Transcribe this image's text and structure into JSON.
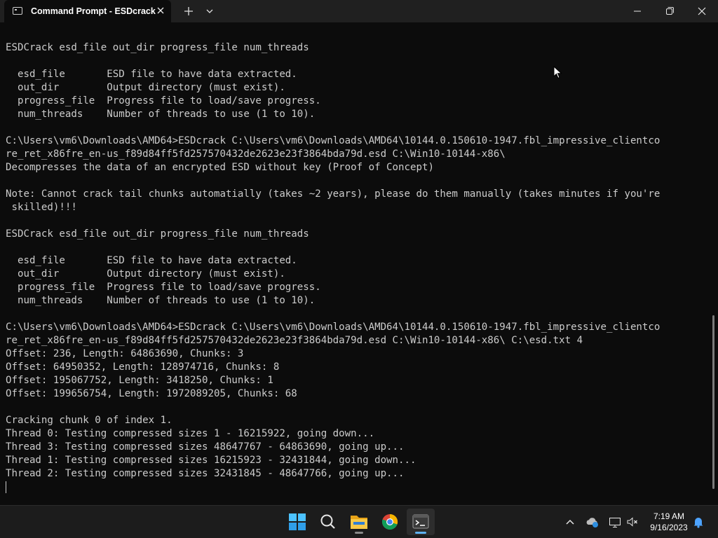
{
  "window": {
    "tab_title": "Command Prompt - ESDcrack",
    "tab_icon": "cmd-icon",
    "new_tab_icon": "plus-icon",
    "dropdown_icon": "chevron-down-icon",
    "minimize_icon": "minimize-icon",
    "restore_icon": "restore-icon",
    "close_icon": "close-icon"
  },
  "terminal": {
    "lines": [
      "ESDCrack esd_file out_dir progress_file num_threads",
      "",
      "  esd_file       ESD file to have data extracted.",
      "  out_dir        Output directory (must exist).",
      "  progress_file  Progress file to load/save progress.",
      "  num_threads    Number of threads to use (1 to 10).",
      "",
      "C:\\Users\\vm6\\Downloads\\AMD64>ESDcrack C:\\Users\\vm6\\Downloads\\AMD64\\10144.0.150610-1947.fbl_impressive_clientco",
      "re_ret_x86fre_en-us_f89d84ff5fd257570432de2623e23f3864bda79d.esd C:\\Win10-10144-x86\\",
      "Decompresses the data of an encrypted ESD without key (Proof of Concept)",
      "",
      "Note: Cannot crack tail chunks automatially (takes ~2 years), please do them manually (takes minutes if you're",
      " skilled)!!!",
      "",
      "ESDCrack esd_file out_dir progress_file num_threads",
      "",
      "  esd_file       ESD file to have data extracted.",
      "  out_dir        Output directory (must exist).",
      "  progress_file  Progress file to load/save progress.",
      "  num_threads    Number of threads to use (1 to 10).",
      "",
      "C:\\Users\\vm6\\Downloads\\AMD64>ESDcrack C:\\Users\\vm6\\Downloads\\AMD64\\10144.0.150610-1947.fbl_impressive_clientco",
      "re_ret_x86fre_en-us_f89d84ff5fd257570432de2623e23f3864bda79d.esd C:\\Win10-10144-x86\\ C:\\esd.txt 4",
      "Offset: 236, Length: 64863690, Chunks: 3",
      "Offset: 64950352, Length: 128974716, Chunks: 8",
      "Offset: 195067752, Length: 3418250, Chunks: 1",
      "Offset: 199656754, Length: 1972089205, Chunks: 68",
      "",
      "Cracking chunk 0 of index 1.",
      "Thread 0: Testing compressed sizes 1 - 16215922, going down...",
      "Thread 3: Testing compressed sizes 48647767 - 64863690, going up...",
      "Thread 1: Testing compressed sizes 16215923 - 32431844, going down...",
      "Thread 2: Testing compressed sizes 32431845 - 48647766, going up..."
    ]
  },
  "taskbar": {
    "apps": [
      {
        "name": "start-button",
        "icon": "windows-logo-icon"
      },
      {
        "name": "search-button",
        "icon": "search-icon"
      },
      {
        "name": "file-explorer-button",
        "icon": "folder-icon"
      },
      {
        "name": "chrome-button",
        "icon": "chrome-icon"
      },
      {
        "name": "terminal-button",
        "icon": "terminal-icon"
      }
    ],
    "tray": {
      "chevron_icon": "chevron-up-icon",
      "onedrive_icon": "cloud-icon",
      "network_icon": "network-icon",
      "volume_icon": "volume-muted-icon",
      "notification_icon": "bell-icon"
    },
    "clock": {
      "time": "7:19 AM",
      "date": "9/16/2023"
    }
  },
  "colors": {
    "terminal_bg": "#0c0c0c",
    "terminal_fg": "#cccccc",
    "titlebar_bg": "#202020",
    "taskbar_bg": "#1c1c1c",
    "accent": "#5fb2f2"
  }
}
